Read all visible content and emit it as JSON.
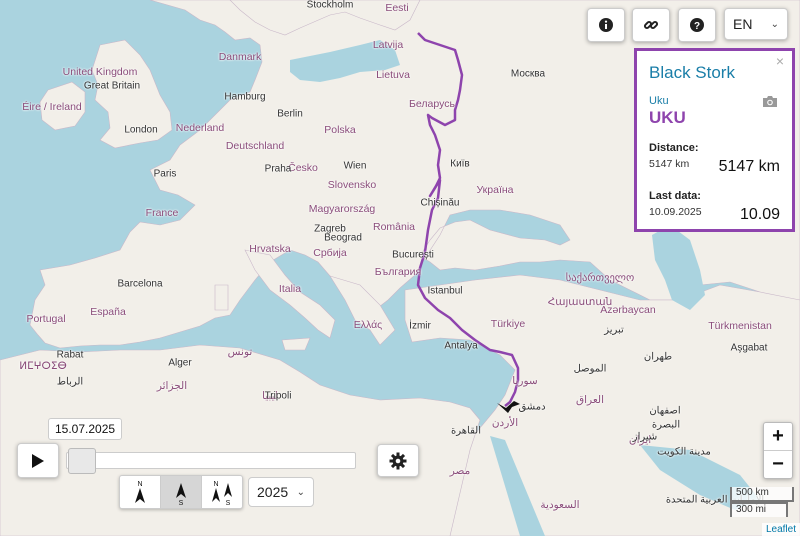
{
  "map": {
    "labels": {
      "countries": [
        "United Kingdom",
        "Éire / Ireland",
        "Nederland",
        "Deutschland",
        "Polska",
        "Česko",
        "Slovensko",
        "Magyarország",
        "France",
        "Hrvatska",
        "Србија",
        "România",
        "България",
        "Italia",
        "España",
        "Portugal",
        "Ελλάς",
        "Türkiye",
        "Україна",
        "Беларусь",
        "Lietuva",
        "Latvija",
        "Eesti",
        "Danmark",
        "Azərbaycan",
        "Türkmenistan",
        "سوريا",
        "العراق",
        "الأردن",
        "مصر",
        "السعودية",
        "ایران",
        "الجزائر",
        "تونس",
        "ليبيا",
        "ⵍⵎⵖⵔⵉⴱ",
        "საქართველო",
        "Հայաստան"
      ],
      "cities": [
        "Stockholm",
        "Great Britain",
        "London",
        "Hamburg",
        "Berlin",
        "Paris",
        "Praha",
        "Wien",
        "Zagreb",
        "Beograd",
        "București",
        "Chișinău",
        "Київ",
        "Москва",
        "Barcelona",
        "Istanbul",
        "İzmir",
        "Antalya",
        "Rabat",
        "Alger",
        "Tripoli",
        "Aşgabat",
        "طهران",
        "الموصل",
        "تبريز",
        "اصفهان",
        "البصرة",
        "شيراز",
        "مدينة الكويت",
        "القاهرة",
        "دمشق",
        "الرباط",
        "الإمارات العربية المتحدة"
      ]
    },
    "track_color": "#8e44ad"
  },
  "topbar": {
    "info_icon": "info-icon",
    "link_icon": "link-icon",
    "help_icon": "help-icon",
    "language": "EN"
  },
  "panel": {
    "species": "Black Stork",
    "close": "×",
    "nickname": "Uku",
    "name": "UKU",
    "distance_label": "Distance:",
    "distance_small": "5147 km",
    "distance_big": "5147 km",
    "last_label": "Last data:",
    "last_small": "10.09.2025",
    "last_big": "10.09"
  },
  "timeline": {
    "date": "15.07.2025",
    "progress": 0.0,
    "year": "2025"
  },
  "north_buttons": [
    {
      "top": "N",
      "bottom": "",
      "name": "north-up-button"
    },
    {
      "top": "",
      "bottom": "S",
      "name": "south-up-button"
    },
    {
      "top": "N",
      "bottom": "S",
      "name": "north-south-button"
    }
  ],
  "zoom": {
    "in": "+",
    "out": "−"
  },
  "scale": {
    "km": "500 km",
    "mi": "300 mi"
  },
  "attribution": "Leaflet"
}
